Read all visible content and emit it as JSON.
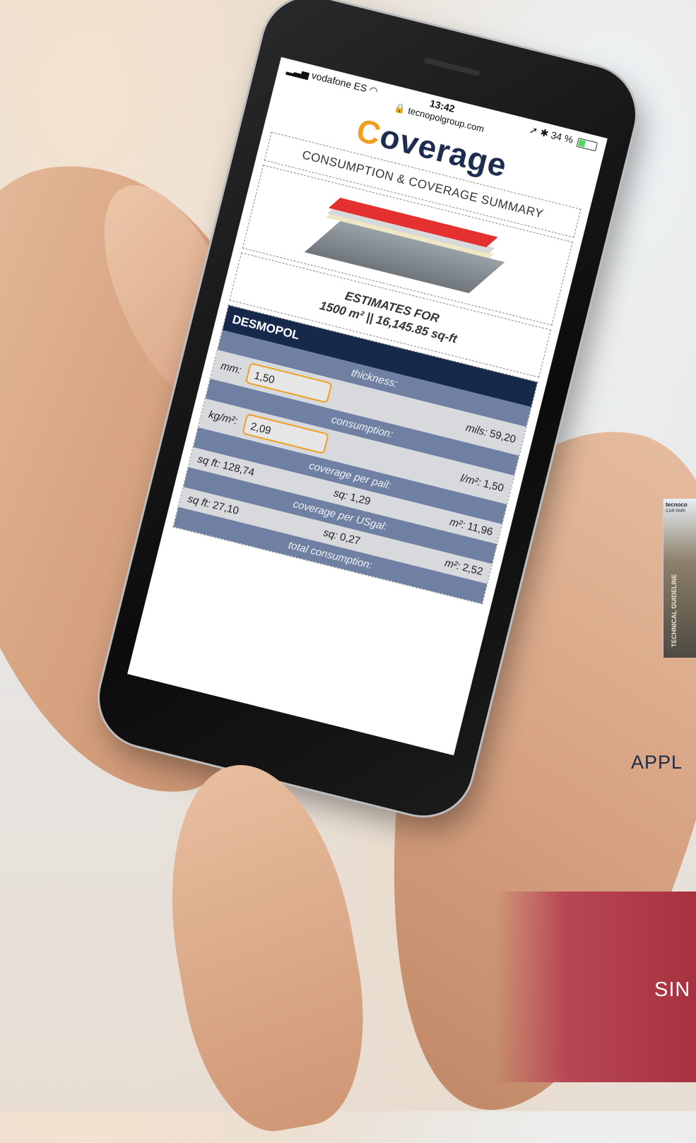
{
  "status_bar": {
    "carrier": "vodafone ES",
    "time": "13:42",
    "url": "tecnopolgroup.com",
    "battery": "34 %"
  },
  "logo": {
    "first_letter": "C",
    "rest": "overage"
  },
  "summary_title": "CONSUMPTION & COVERAGE SUMMARY",
  "estimates": {
    "line1": "ESTIMATES FOR",
    "line2": "1500 m² || 16,145.85 sq-ft"
  },
  "calculator": {
    "product": "DESMOPOL",
    "thickness": {
      "header": "thickness:",
      "mm_label": "mm:",
      "mm_value": "1,50",
      "mils_label": "mils:",
      "mils_value": "59,20"
    },
    "consumption": {
      "header": "consumption:",
      "kg_label": "kg/m²:",
      "kg_value": "2,09",
      "l_label": "l/m²:",
      "l_value": "1,50"
    },
    "coverage_pail": {
      "header": "coverage per pail:",
      "sqft_label": "sq ft:",
      "sqft_value": "128,74",
      "sq_label": "sq:",
      "sq_value": "1,29",
      "m2_label": "m²:",
      "m2_value": "11,96"
    },
    "coverage_usgal": {
      "header": "coverage per USgal:",
      "sqft_label": "sq ft:",
      "sqft_value": "27,10",
      "sq_label": "sq:",
      "sq_value": "0,27",
      "m2_label": "m²:",
      "m2_value": "2,52"
    },
    "total_header": "total consumption:"
  },
  "brochure": {
    "logo": "tecnoco",
    "subtitle": "CAR PARI",
    "vertical": "TECHNICAL GUIDELINE"
  },
  "background_texts": {
    "appl": "APPL",
    "sin": "SIN"
  },
  "colors": {
    "navy": "#17294a",
    "accent_orange": "#f0a021",
    "row_blue": "#6f80a2",
    "band_red": "#b84655"
  }
}
